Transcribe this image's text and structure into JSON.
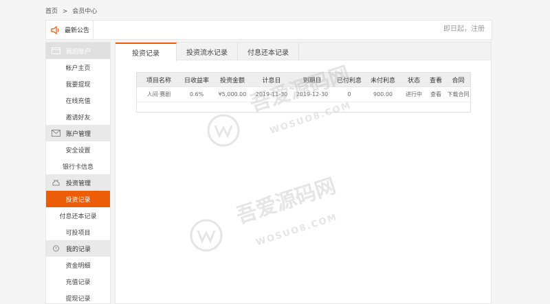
{
  "breadcrumb": {
    "home": "首页",
    "sep": ">",
    "current": "会员中心"
  },
  "notice": {
    "title": "最新公告",
    "scroll_text": "即日起，注册"
  },
  "sidebar": {
    "groups": [
      {
        "label": "我的账户",
        "items": [
          "帐户主页",
          "我要提现",
          "在线充值",
          "邀请好友"
        ]
      },
      {
        "label": "账户管理",
        "items": [
          "安全设置",
          "银行卡信息"
        ]
      },
      {
        "label": "投资管理",
        "items": [
          "投资记录",
          "付息还本记录",
          "可投项目"
        ]
      },
      {
        "label": "我的记录",
        "items": [
          "资金明细",
          "充值记录",
          "提现记录"
        ]
      }
    ],
    "active_item": "投资记录"
  },
  "tabs": [
    {
      "label": "投资记录",
      "active": true
    },
    {
      "label": "投资流水记录",
      "active": false
    },
    {
      "label": "付息还本记录",
      "active": false
    }
  ],
  "table": {
    "headers": [
      "项目名称",
      "日收益率",
      "投资金额",
      "计息日",
      "到期日",
      "已付利息",
      "未付利息",
      "状态",
      "查看",
      "合同"
    ],
    "rows": [
      [
        "人间·赛剧",
        "0.6%",
        "¥5,000.00",
        "2019-11-30",
        "2019-12-30",
        "0",
        "900.00",
        "进行中",
        "查看",
        "下载合同"
      ]
    ]
  },
  "watermark": {
    "text": "吾爱源码网",
    "sub": "WOSUO8.COM"
  },
  "colors": {
    "accent": "#ed5d08"
  }
}
